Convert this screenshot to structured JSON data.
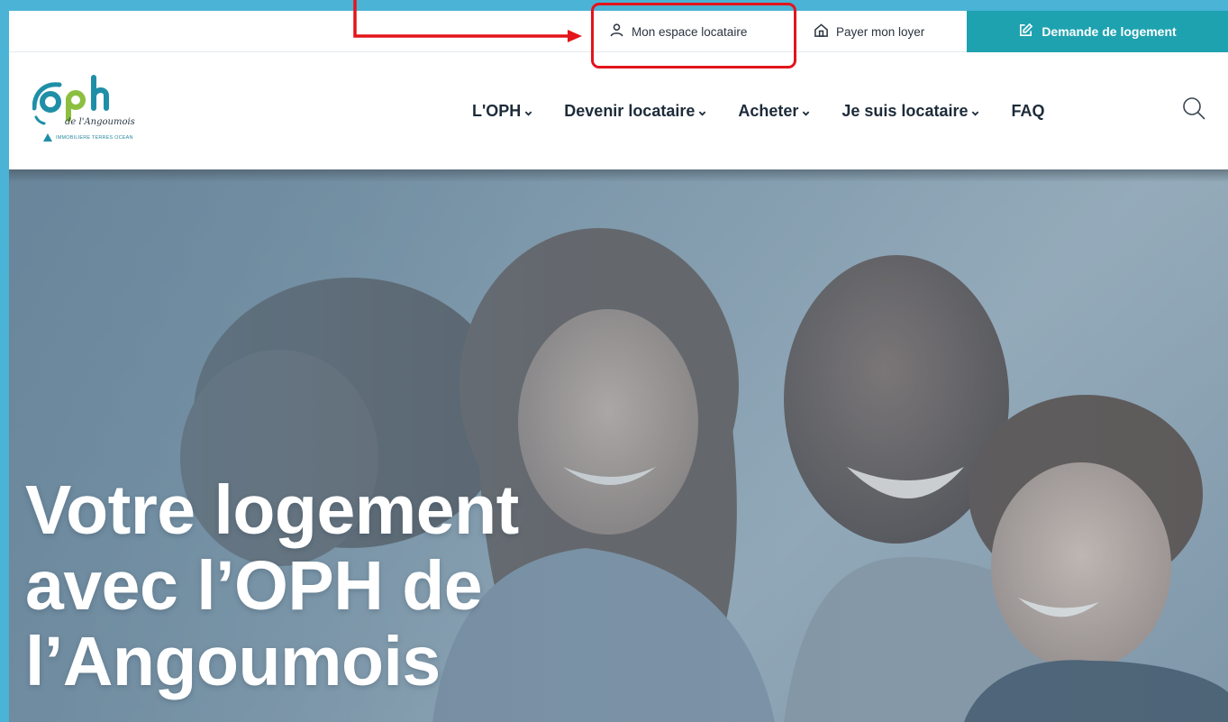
{
  "topbar": {
    "espace_label": "Mon espace locataire",
    "loyer_label": "Payer mon loyer",
    "demande_label": "Demande de logement"
  },
  "logo": {
    "wordmark": "OPH",
    "script_line": "de l'Angoumois",
    "tagline": "IMMOBILIERE TERRES OCEAN"
  },
  "nav": {
    "items": [
      {
        "label": "L'OPH",
        "has_dropdown": true
      },
      {
        "label": "Devenir locataire",
        "has_dropdown": true
      },
      {
        "label": "Acheter",
        "has_dropdown": true
      },
      {
        "label": "Je suis locataire",
        "has_dropdown": true
      },
      {
        "label": "FAQ",
        "has_dropdown": false
      }
    ],
    "search_icon": "search-icon"
  },
  "hero": {
    "title_lines": [
      "Votre logement",
      "avec l’OPH de",
      "l’Angoumois"
    ]
  },
  "colors": {
    "accent": "#1fa2b0",
    "frame": "#4ab3d6",
    "annotation": "#e3141b",
    "logo_green": "#8cbf3f",
    "logo_blue": "#1f8fa8"
  }
}
